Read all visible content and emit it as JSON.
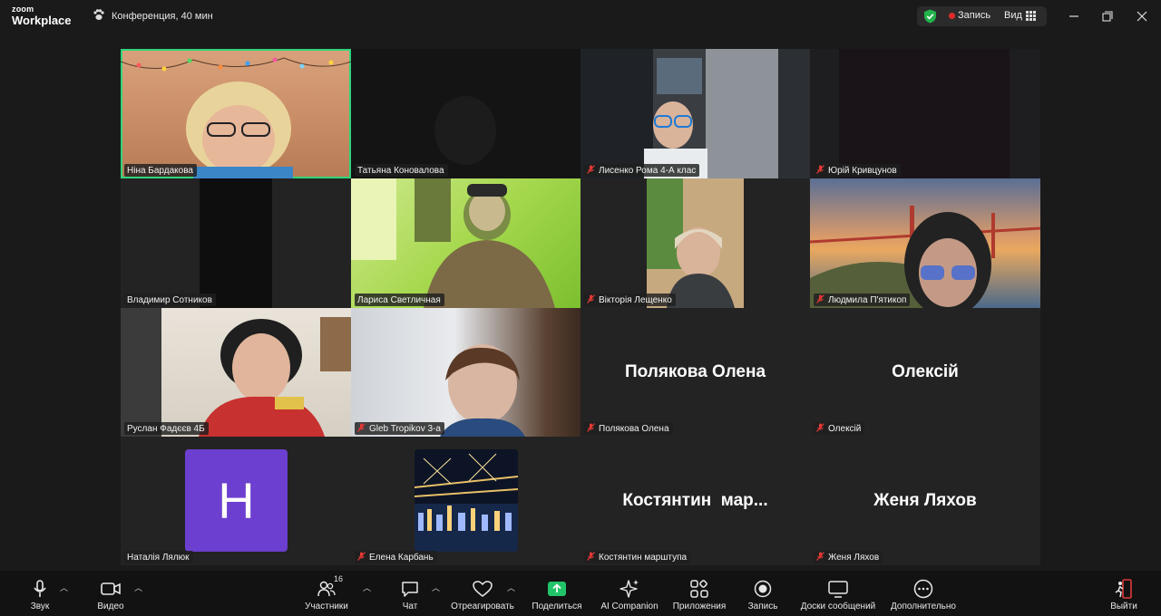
{
  "app": {
    "logo_top": "zoom",
    "logo_bottom": "Workplace"
  },
  "meeting": {
    "title": "Конференция, 40 мин"
  },
  "header": {
    "record_label": "Запись",
    "view_label": "Вид"
  },
  "colors": {
    "active_speaker": "#2fd67b",
    "share": "#22c46a",
    "record_dot": "#e02a2a",
    "avatar_bg": "#6c3fd0",
    "leave": "#e0393a"
  },
  "participants": [
    {
      "name": "Ніна Бардакова",
      "muted": false,
      "active": true
    },
    {
      "name": "Татьяна Коновалова",
      "muted": false
    },
    {
      "name": "Лисенко Рома 4-А клас",
      "muted": true
    },
    {
      "name": "Юрій Кривцунов",
      "muted": true
    },
    {
      "name": "Владимир Сотников",
      "muted": false
    },
    {
      "name": "Лариса Светличная",
      "muted": false
    },
    {
      "name": "Вікторія Лещенко",
      "muted": true
    },
    {
      "name": "Людмила П'ятикоп",
      "muted": true
    },
    {
      "name": "Руслан Фадєєв 4Б",
      "muted": false
    },
    {
      "name": "Gleb Tropikov 3-а",
      "muted": true
    },
    {
      "name": "Полякова Олена",
      "muted": true,
      "display": "Полякова Олена"
    },
    {
      "name": "Олексій",
      "muted": true,
      "display": "Олексій"
    },
    {
      "name": "Наталія Лялюк",
      "muted": false,
      "avatar_letter": "H"
    },
    {
      "name": "Елена Карбань",
      "muted": true
    },
    {
      "name": "Костянтин марштупа",
      "muted": true,
      "display": "Костянтин  мар..."
    },
    {
      "name": "Женя Ляхов",
      "muted": true,
      "display": "Женя Ляхов"
    }
  ],
  "toolbar": {
    "audio": "Звук",
    "video": "Видео",
    "participants": "Участники",
    "participants_count": "16",
    "chat": "Чат",
    "react": "Отреагировать",
    "share": "Поделиться",
    "ai": "AI Companion",
    "apps": "Приложения",
    "record": "Запись",
    "whiteboards": "Доски сообщений",
    "more": "Дополнительно",
    "leave": "Выйти"
  }
}
